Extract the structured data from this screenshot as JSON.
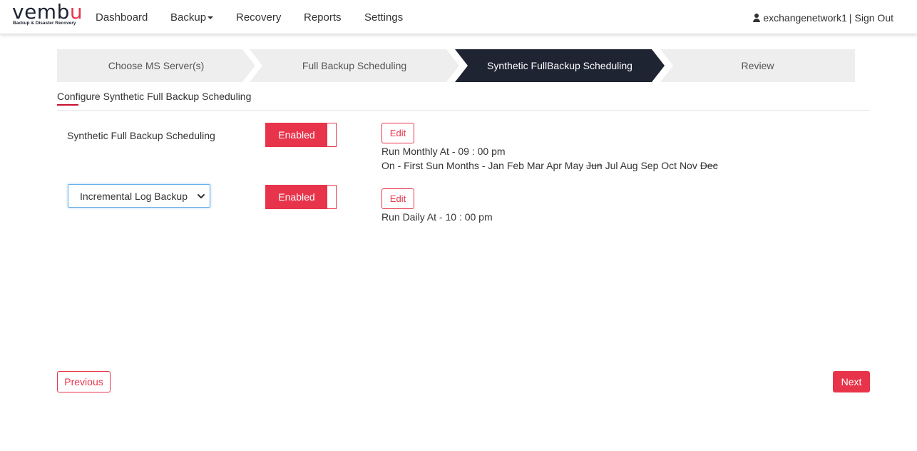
{
  "brand": {
    "name_main": "vemb",
    "name_accent": "u",
    "tagline": "Backup & Disaster Recovery"
  },
  "nav": {
    "dashboard": "Dashboard",
    "backup": "Backup",
    "recovery": "Recovery",
    "reports": "Reports",
    "settings": "Settings"
  },
  "user": {
    "name": "exchangenetwork1",
    "separator": "|",
    "sign_out": "Sign Out"
  },
  "steps": [
    {
      "label": "Choose MS Server(s)",
      "active": false
    },
    {
      "label": "Full Backup Scheduling",
      "active": false
    },
    {
      "label": "Synthetic FullBackup Scheduling",
      "active": true
    },
    {
      "label": "Review",
      "active": false
    }
  ],
  "section": {
    "title": "Configure Synthetic Full Backup Scheduling"
  },
  "synthetic": {
    "label": "Synthetic Full Backup Scheduling",
    "toggle_label": "Enabled",
    "edit_label": "Edit",
    "run_text": "Run Monthly At - 09 : 00 pm",
    "on_prefix": "On - First Sun Months -",
    "months": [
      {
        "name": "Jan",
        "excluded": false
      },
      {
        "name": "Feb",
        "excluded": false
      },
      {
        "name": "Mar",
        "excluded": false
      },
      {
        "name": "Apr",
        "excluded": false
      },
      {
        "name": "May",
        "excluded": false
      },
      {
        "name": "Jun",
        "excluded": true
      },
      {
        "name": "Jul",
        "excluded": false
      },
      {
        "name": "Aug",
        "excluded": false
      },
      {
        "name": "Sep",
        "excluded": false
      },
      {
        "name": "Oct",
        "excluded": false
      },
      {
        "name": "Nov",
        "excluded": false
      },
      {
        "name": "Dec",
        "excluded": true
      }
    ]
  },
  "incremental": {
    "select_value": "Incremental Log Backup",
    "toggle_label": "Enabled",
    "edit_label": "Edit",
    "run_text": "Run Daily At - 10 : 00 pm"
  },
  "footer": {
    "previous": "Previous",
    "next": "Next"
  },
  "colors": {
    "accent": "#e8344a",
    "dark": "#1f2433",
    "step_bg": "#eeeeee"
  }
}
